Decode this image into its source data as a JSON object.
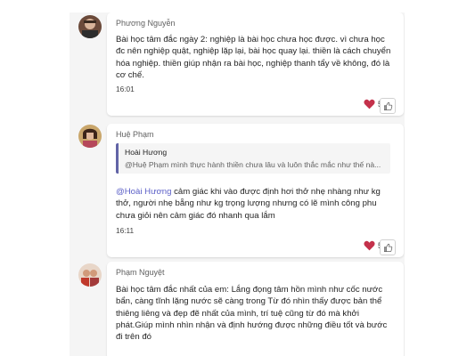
{
  "messages": [
    {
      "author": "Phương Nguyễn",
      "text": "Bài học tâm đắc ngày 2: nghiệp là bài học chưa học được. vì chưa học đc nên nghiệp quật, nghiệp lặp lại, bài học quay lại. thiền là cách chuyển hóa nghiệp. thiền giúp nhận ra bài học, nghiệp thanh tẩy về không, đó là cơ chế.",
      "time": "16:01",
      "reactions": {
        "icon": "heart-icon",
        "count": "5"
      }
    },
    {
      "author": "Huệ Phạm",
      "quote": {
        "author": "Hoài Hương",
        "text": "@Huệ Phạm mình thực hành thiền chưa lâu và luôn thắc mắc như thế nà..."
      },
      "mention": "@Hoài Hương",
      "text": " cảm giác khi vào được định hơi thở nhẹ nhàng như kg thở, người nhẹ bẵng như kg trọng lượng nhưng có lẽ mình công phu chưa giỏi nên cảm giác đó nhanh qua lắm",
      "time": "16:11",
      "reactions": {
        "icon": "heart-icon",
        "count": "5"
      }
    },
    {
      "author": "Phạm Nguyệt",
      "text": "Bài học tâm đắc nhất của em: Lắng đọng tâm hồn mình như cốc nước bẩn, càng tĩnh lặng nước sẽ càng trong Từ đó nhìn thấy được bản thể thiêng liêng và đẹp đẽ nhất của mình, trí tuệ cũng từ đó mà khởi phát.Giúp mình nhìn nhận và định hướng được những điều tốt và bước đi trên đó"
    }
  ],
  "colors": {
    "accent": "#6264a7",
    "mention": "#5b5fc7",
    "heart": "#c4314b"
  }
}
